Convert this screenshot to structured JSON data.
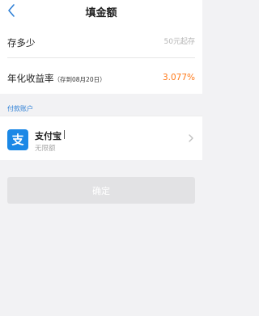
{
  "nav": {
    "title": "填金额",
    "back_icon": "chevron-left-icon"
  },
  "form": {
    "amount_label": "存多少",
    "amount_placeholder": "50元起存",
    "rate_label": "年化收益率",
    "rate_note": "（存到08月20日）",
    "rate_value": "3.077%"
  },
  "payment": {
    "section_title": "付款账户",
    "method_name": "支付宝",
    "method_limit": "无限额",
    "logo_glyph": "支",
    "logo_icon": "alipay-icon",
    "brand_color": "#1b88e6"
  },
  "confirm": {
    "label": "确定"
  },
  "colors": {
    "accent_blue": "#2f80d6",
    "rate_orange": "#ff7a1a",
    "disabled_button": "#e2e2e4"
  }
}
